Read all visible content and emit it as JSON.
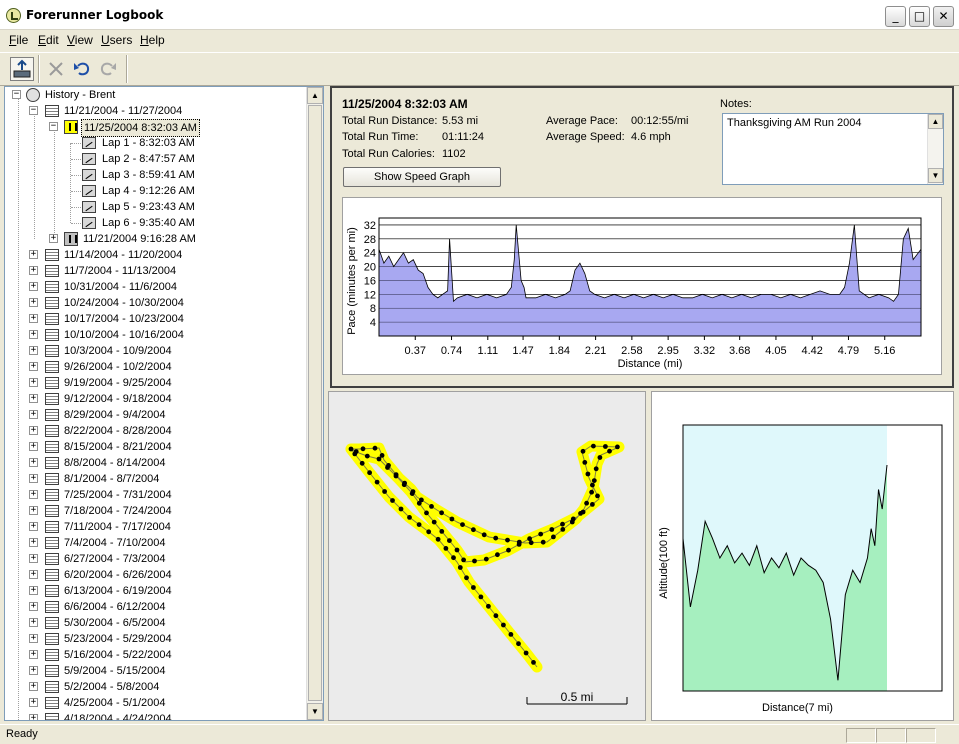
{
  "window": {
    "title": "Forerunner Logbook"
  },
  "window_buttons": {
    "minimize": "_",
    "maximize": "□",
    "close": "✕"
  },
  "menu": [
    {
      "underline": "F",
      "rest": "ile"
    },
    {
      "underline": "E",
      "rest": "dit"
    },
    {
      "underline": "V",
      "rest": "iew"
    },
    {
      "underline": "U",
      "rest": "sers"
    },
    {
      "underline": "H",
      "rest": "elp"
    }
  ],
  "toolbar": {
    "icons": [
      "receive-from-device-icon",
      "delete-icon",
      "undo-icon",
      "redo-icon"
    ]
  },
  "tree": {
    "root": "History - Brent",
    "expanded_week": "11/21/2004 - 11/27/2004",
    "selected_run": "11/25/2004 8:32:03 AM",
    "laps": [
      "Lap 1 - 8:32:03 AM",
      "Lap 2 - 8:47:57 AM",
      "Lap 3 - 8:59:41 AM",
      "Lap 4 - 9:12:26 AM",
      "Lap 5 - 9:23:43 AM",
      "Lap 6 - 9:35:40 AM"
    ],
    "other_run": "11/21/2004 9:16:28 AM",
    "weeks": [
      "11/14/2004 - 11/20/2004",
      "11/7/2004 - 11/13/2004",
      "10/31/2004 - 11/6/2004",
      "10/24/2004 - 10/30/2004",
      "10/17/2004 - 10/23/2004",
      "10/10/2004 - 10/16/2004",
      "10/3/2004 - 10/9/2004",
      "9/26/2004 - 10/2/2004",
      "9/19/2004 - 9/25/2004",
      "9/12/2004 - 9/18/2004",
      "8/29/2004 - 9/4/2004",
      "8/22/2004 - 8/28/2004",
      "8/15/2004 - 8/21/2004",
      "8/8/2004 - 8/14/2004",
      "8/1/2004 - 8/7/2004",
      "7/25/2004 - 7/31/2004",
      "7/18/2004 - 7/24/2004",
      "7/11/2004 - 7/17/2004",
      "7/4/2004 - 7/10/2004",
      "6/27/2004 - 7/3/2004",
      "6/20/2004 - 6/26/2004",
      "6/13/2004 - 6/19/2004",
      "6/6/2004 - 6/12/2004",
      "5/30/2004 - 6/5/2004",
      "5/23/2004 - 5/29/2004",
      "5/16/2004 - 5/22/2004",
      "5/9/2004 - 5/15/2004",
      "5/2/2004 - 5/8/2004",
      "4/25/2004 - 5/1/2004",
      "4/18/2004 - 4/24/2004"
    ]
  },
  "summary": {
    "header": "11/25/2004  8:32:03 AM",
    "distance_label": "Total Run Distance:",
    "distance_value": "5.53 mi",
    "time_label": "Total Run Time:",
    "time_value": "01:11:24",
    "calories_label": "Total Run Calories:",
    "calories_value": "1102",
    "pace_label": "Average Pace:",
    "pace_value": "00:12:55/mi",
    "speed_label": "Average Speed:",
    "speed_value": "4.6 mph",
    "speed_button": "Show Speed Graph",
    "notes_label": "Notes:",
    "notes_text": "Thanksgiving AM Run 2004"
  },
  "map": {
    "scale_label": "0.5 mi"
  },
  "status": {
    "text": "Ready"
  },
  "chart_data": [
    {
      "type": "area",
      "ylabel": "Pace (minutes per mi)",
      "xlabel": "Distance (mi)",
      "xlim": [
        0,
        5.53
      ],
      "ylim": [
        0,
        34
      ],
      "yticks": [
        4,
        8,
        12,
        16,
        20,
        24,
        28,
        32
      ],
      "xticks": [
        "0.37",
        "0.74",
        "1.11",
        "1.47",
        "1.84",
        "2.21",
        "2.58",
        "2.95",
        "3.32",
        "3.68",
        "4.05",
        "4.42",
        "4.79",
        "5.16"
      ],
      "x": [
        0,
        0.05,
        0.1,
        0.15,
        0.2,
        0.25,
        0.3,
        0.35,
        0.4,
        0.45,
        0.5,
        0.55,
        0.6,
        0.65,
        0.7,
        0.72,
        0.76,
        0.8,
        0.9,
        1.0,
        1.1,
        1.2,
        1.3,
        1.35,
        1.38,
        1.4,
        1.45,
        1.48,
        1.5,
        1.6,
        1.7,
        1.8,
        1.9,
        1.95,
        2.0,
        2.05,
        2.1,
        2.15,
        2.2,
        2.3,
        2.4,
        2.5,
        2.6,
        2.7,
        2.8,
        2.9,
        3.0,
        3.1,
        3.2,
        3.3,
        3.4,
        3.5,
        3.6,
        3.7,
        3.8,
        3.9,
        4.0,
        4.1,
        4.2,
        4.3,
        4.4,
        4.5,
        4.6,
        4.7,
        4.75,
        4.8,
        4.85,
        4.9,
        5.0,
        5.1,
        5.2,
        5.25,
        5.3,
        5.35,
        5.4,
        5.45,
        5.53
      ],
      "y": [
        25,
        21,
        23,
        20,
        22,
        24,
        21,
        22,
        19,
        18,
        14,
        12,
        11,
        12,
        13,
        28,
        10,
        11,
        12,
        11,
        12,
        11,
        12,
        14,
        22,
        32,
        16,
        14,
        11,
        11,
        12,
        11,
        12,
        13,
        19,
        21,
        18,
        13,
        12,
        11,
        12,
        11,
        12,
        11,
        12,
        11,
        12,
        11,
        11,
        12,
        11,
        12,
        11,
        12,
        11,
        12,
        12,
        11,
        12,
        11,
        12,
        13,
        12,
        12,
        14,
        21,
        32,
        13,
        11,
        12,
        11,
        10,
        12,
        28,
        31,
        22,
        25
      ]
    },
    {
      "type": "area",
      "ylabel": "Altitude(100 ft)",
      "xlabel": "Distance(7 mi)",
      "x": [
        0,
        0.2,
        0.4,
        0.6,
        0.8,
        1.0,
        1.2,
        1.4,
        1.6,
        1.8,
        2.0,
        2.2,
        2.4,
        2.6,
        2.8,
        3.0,
        3.2,
        3.4,
        3.6,
        3.8,
        4.0,
        4.2,
        4.4,
        4.6,
        4.8,
        5.0,
        5.1,
        5.2,
        5.3,
        5.4,
        5.53
      ],
      "y": [
        0.58,
        0.3,
        0.45,
        0.65,
        0.58,
        0.5,
        0.55,
        0.48,
        0.52,
        0.47,
        0.55,
        0.44,
        0.5,
        0.46,
        0.52,
        0.43,
        0.5,
        0.47,
        0.45,
        0.4,
        0.25,
        0.0,
        0.35,
        0.45,
        0.4,
        0.5,
        0.62,
        0.55,
        0.78,
        0.7,
        0.88
      ]
    }
  ]
}
